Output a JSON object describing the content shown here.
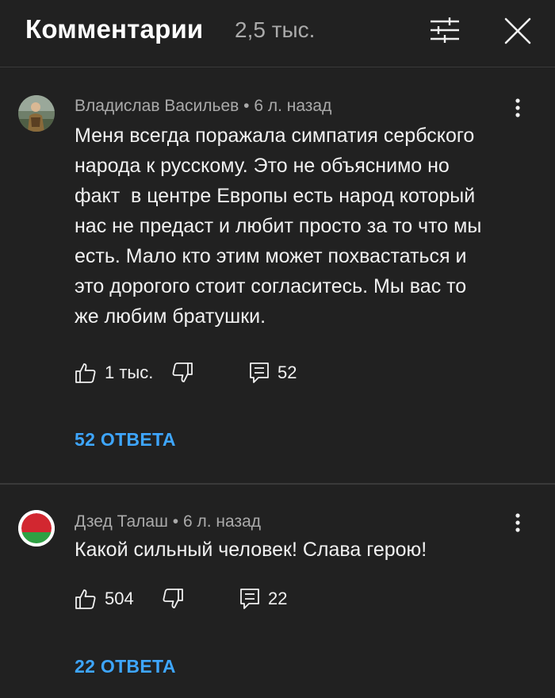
{
  "header": {
    "title": "Комментарии",
    "count": "2,5 тыс.",
    "filter_icon": "sliders-icon",
    "close_icon": "close-icon"
  },
  "comments": [
    {
      "author": "Владислав Васильев",
      "time": "6 л. назад",
      "meta": "Владислав Васильев • 6 л. назад",
      "text": "Меня всегда поражала симпатия сербского\nнарода к русскому. Это не объяснимо но\nфакт  в центре Европы есть народ который\nнас не предаст и любит просто за то что мы\nесть. Мало кто этим может похвастаться и\nэто дорогого стоит согласитесь. Мы вас то\nже любим братушки.",
      "likes": "1 тыс.",
      "replies_count": "52",
      "replies_link": "52 ОТВЕТА"
    },
    {
      "author": "Дзед Талаш",
      "time": "6 л. назад",
      "meta": "Дзед Талаш • 6 л. назад",
      "text": "Какой сильный человек! Слава герою!",
      "likes": "504",
      "replies_count": "22",
      "replies_link": "22 ОТВЕТА"
    }
  ],
  "colors": {
    "background": "#212121",
    "divider": "#3a3a3a",
    "link": "#3ea6ff",
    "secondary_text": "#aaaaaa",
    "flag_red": "#d22730",
    "flag_green": "#2ea043"
  }
}
